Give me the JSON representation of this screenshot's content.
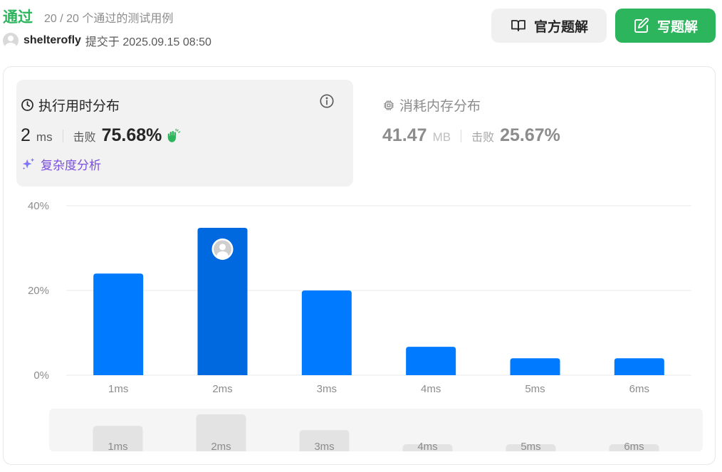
{
  "header": {
    "status": "通过",
    "tests": "20 / 20 个通过的测试用例",
    "username": "shelterofly",
    "submit_time": "提交于 2025.09.15 08:50",
    "official_label": "官方题解",
    "write_label": "写题解"
  },
  "runtime": {
    "title": "执行用时分布",
    "value": "2",
    "unit": "ms",
    "beat_label": "击败",
    "beat_value": "75.68%",
    "complexity_label": "复杂度分析"
  },
  "memory": {
    "title": "消耗内存分布",
    "value": "41.47",
    "unit": "MB",
    "beat_label": "击败",
    "beat_value": "25.67%"
  },
  "colors": {
    "accent_green": "#2db55d",
    "bar": "#007aff",
    "bar_selected": "#0069e0",
    "complexity": "#7a4ede"
  },
  "chart_data": {
    "type": "bar",
    "categories": [
      "1ms",
      "2ms",
      "3ms",
      "4ms",
      "5ms",
      "6ms"
    ],
    "values": [
      24,
      34.8,
      20,
      6.7,
      4,
      4
    ],
    "selected_index": 1,
    "yticks": [
      "0%",
      "20%",
      "40%"
    ],
    "ylim": [
      0,
      40
    ],
    "grid": true,
    "overview_values": [
      24,
      34.8,
      20,
      6.7,
      4,
      4
    ]
  }
}
